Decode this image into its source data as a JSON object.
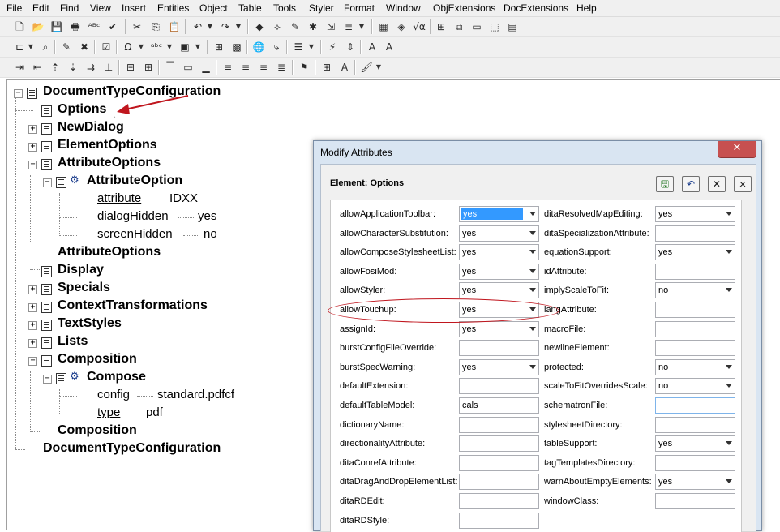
{
  "menu": [
    "File",
    "Edit",
    "Find",
    "View",
    "Insert",
    "Entities",
    "Object",
    "Table",
    "Tools",
    "Styler",
    "Format",
    "Window",
    "ObjExtensions",
    "DocExtensions",
    "Help"
  ],
  "toolbars": {
    "row1": [
      "new-icon",
      "open-icon",
      "save-icon",
      "print-icon",
      "spellcheck-icon",
      "thesaurus-icon",
      "cut-icon",
      "copy-icon",
      "paste-icon",
      "undo-icon",
      "redo-icon",
      "insert-element-icon",
      "change-element-icon",
      "equation-icon",
      "obj-tool-1-icon",
      "obj-tool-2-icon",
      "obj-tool-3-icon"
    ],
    "row2": [
      "tag-icon",
      "find-icon",
      "draw-icon",
      "delete-icon",
      "check-icon",
      "omega-icon",
      "abc-icon",
      "form-icon",
      "table-insert-icon",
      "image-icon",
      "link-icon",
      "list-icon",
      "para-icon",
      "zoom-icon",
      "font-bigger-icon"
    ],
    "row3": [
      "indent-icon",
      "outdent-icon",
      "move-up-icon",
      "move-down-icon",
      "split-icon",
      "join-icon",
      "table-row-icon",
      "table-col-icon",
      "frame-icon",
      "align-left-icon",
      "align-center-icon",
      "align-right-icon",
      "justify-icon",
      "style-icon",
      "grid-icon",
      "italic-a-icon",
      "paint-icon"
    ]
  },
  "tree": {
    "root_open": "DocumentTypeConfiguration",
    "options": "Options",
    "newdialog": "NewDialog",
    "elementoptions": "ElementOptions",
    "attributeoptions_open": "AttributeOptions",
    "attributeoption": "AttributeOption",
    "attr1_name": "attribute",
    "attr1_value": "IDXX",
    "attr2_name": "dialogHidden",
    "attr2_value": "yes",
    "attr3_name": "screenHidden",
    "attr3_value": "no",
    "attributeoptions_close": "AttributeOptions",
    "display": "Display",
    "specials": "Specials",
    "contexttransformations": "ContextTransformations",
    "textstyles": "TextStyles",
    "lists": "Lists",
    "composition_open": "Composition",
    "compose": "Compose",
    "compose_attr1_name": "config",
    "compose_attr1_value": "standard.pdfcf",
    "compose_attr2_name": "type",
    "compose_attr2_value": "pdf",
    "composition_close": "Composition",
    "root_close": "DocumentTypeConfiguration"
  },
  "dialog": {
    "title": "Modify Attributes",
    "close_glyph": "✕",
    "element_label": "Element:  Options",
    "buttons": [
      "apply-icon",
      "undo-icon",
      "close-icon",
      "cancel-all-icon"
    ],
    "left_column": [
      {
        "label": "allowApplicationToolbar:",
        "value": "yes",
        "dropdown": true,
        "selected": true
      },
      {
        "label": "allowCharacterSubstitution:",
        "value": "yes",
        "dropdown": true
      },
      {
        "label": "allowComposeStylesheetList:",
        "value": "yes",
        "dropdown": true
      },
      {
        "label": "allowFosiMod:",
        "value": "yes",
        "dropdown": true
      },
      {
        "label": "allowStyler:",
        "value": "yes",
        "dropdown": true
      },
      {
        "label": "allowTouchup:",
        "value": "yes",
        "dropdown": true
      },
      {
        "label": "assignId:",
        "value": "yes",
        "dropdown": true
      },
      {
        "label": "burstConfigFileOverride:",
        "value": "",
        "dropdown": false
      },
      {
        "label": "burstSpecWarning:",
        "value": "yes",
        "dropdown": true
      },
      {
        "label": "defaultExtension:",
        "value": "",
        "dropdown": false
      },
      {
        "label": "defaultTableModel:",
        "value": "cals",
        "dropdown": false
      },
      {
        "label": "dictionaryName:",
        "value": "",
        "dropdown": false
      },
      {
        "label": "directionalityAttribute:",
        "value": "",
        "dropdown": false
      },
      {
        "label": "ditaConrefAttribute:",
        "value": "",
        "dropdown": false
      },
      {
        "label": "ditaDragAndDropElementList:",
        "value": "",
        "dropdown": false
      },
      {
        "label": "ditaRDEdit:",
        "value": "",
        "dropdown": false
      },
      {
        "label": "ditaRDStyle:",
        "value": "",
        "dropdown": false
      }
    ],
    "right_column": [
      {
        "label": "ditaResolvedMapEditing:",
        "value": "yes",
        "dropdown": true
      },
      {
        "label": "ditaSpecializationAttribute:",
        "value": "",
        "dropdown": false
      },
      {
        "label": "equationSupport:",
        "value": "yes",
        "dropdown": true
      },
      {
        "label": "idAttribute:",
        "value": "",
        "dropdown": false
      },
      {
        "label": "implyScaleToFit:",
        "value": "no",
        "dropdown": true
      },
      {
        "label": "langAttribute:",
        "value": "",
        "dropdown": false
      },
      {
        "label": "macroFile:",
        "value": "",
        "dropdown": false
      },
      {
        "label": "newlineElement:",
        "value": "",
        "dropdown": false
      },
      {
        "label": "protected:",
        "value": "no",
        "dropdown": true
      },
      {
        "label": "scaleToFitOverridesScale:",
        "value": "no",
        "dropdown": true
      },
      {
        "label": "schematronFile:",
        "value": "",
        "dropdown": false,
        "focus": true
      },
      {
        "label": "stylesheetDirectory:",
        "value": "",
        "dropdown": false
      },
      {
        "label": "tableSupport:",
        "value": "yes",
        "dropdown": true
      },
      {
        "label": "tagTemplatesDirectory:",
        "value": "",
        "dropdown": false
      },
      {
        "label": "warnAboutEmptyElements:",
        "value": "yes",
        "dropdown": true
      },
      {
        "label": "windowClass:",
        "value": "",
        "dropdown": false
      }
    ]
  },
  "colors": {
    "annotation": "#c0161e",
    "selection": "#3399ff",
    "dialog_frame": "#d9e5f2",
    "close_button": "#c75050"
  }
}
